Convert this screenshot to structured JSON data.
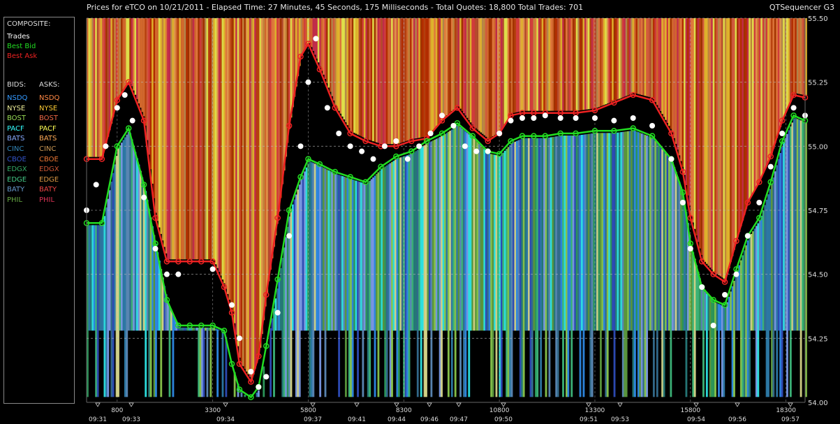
{
  "header": {
    "title": "Prices for  eTCO  on  10/21/2011  -  Elapsed Time: 27 Minutes, 45 Seconds, 175 Milliseconds  -  Total Quotes: 18,800  Total Trades: 701",
    "app": "QTSequencer G3"
  },
  "legend": {
    "composite_heading": "COMPOSITE:",
    "composite": [
      {
        "label": "Trades",
        "color": "#ffffff"
      },
      {
        "label": "Best Bid",
        "color": "#22dd22"
      },
      {
        "label": "Best Ask",
        "color": "#ee2222"
      }
    ],
    "bids_heading": "BIDS:",
    "asks_heading": "ASKS:",
    "exchanges": [
      {
        "bid": "NSDQ",
        "ask": "NSDQ",
        "bid_color": "#3399ff",
        "ask_color": "#ff8844"
      },
      {
        "bid": "NYSE",
        "ask": "NYSE",
        "bid_color": "#eeee99",
        "ask_color": "#ffcc33"
      },
      {
        "bid": "BOST",
        "ask": "BOST",
        "bid_color": "#99dd55",
        "ask_color": "#ee6644"
      },
      {
        "bid": "PACF",
        "ask": "PACF",
        "bid_color": "#33ffff",
        "ask_color": "#ffff55"
      },
      {
        "bid": "BATS",
        "ask": "BATS",
        "bid_color": "#88aaff",
        "ask_color": "#ffaa55"
      },
      {
        "bid": "CINC",
        "ask": "CINC",
        "bid_color": "#3388bb",
        "ask_color": "#cc9955"
      },
      {
        "bid": "CBOE",
        "ask": "CBOE",
        "bid_color": "#3355cc",
        "ask_color": "#ee7733"
      },
      {
        "bid": "EDGX",
        "ask": "EDGX",
        "bid_color": "#33aa66",
        "ask_color": "#cc5533"
      },
      {
        "bid": "EDGE",
        "ask": "EDGE",
        "bid_color": "#44cc88",
        "ask_color": "#dd9944"
      },
      {
        "bid": "BATY",
        "ask": "BATY",
        "bid_color": "#6699cc",
        "ask_color": "#ee4444"
      },
      {
        "bid": "PHIL",
        "ask": "PHIL",
        "bid_color": "#66aa44",
        "ask_color": "#dd3355"
      }
    ]
  },
  "chart_data": {
    "type": "line",
    "ylim": [
      54.0,
      55.5
    ],
    "y_ticks": [
      "55.50",
      "55.25",
      "55.00",
      "54.75",
      "54.50",
      "54.25",
      "54.00"
    ],
    "x_count_labels": [
      "800",
      "3300",
      "5800",
      "8300",
      "10800",
      "13300",
      "15800",
      "18300"
    ],
    "x_time_labels": [
      "09:31",
      "09:33",
      "09:34",
      "09:37",
      "09:41",
      "09:44",
      "09:46",
      "09:47",
      "09:50",
      "09:51",
      "09:53",
      "09:54",
      "09:56",
      "09:57"
    ],
    "xlim": [
      0,
      18800
    ],
    "best_bid": {
      "x": [
        0,
        400,
        800,
        1100,
        1500,
        1800,
        2100,
        2400,
        2700,
        3000,
        3300,
        3600,
        3800,
        4000,
        4300,
        4500,
        4700,
        5000,
        5300,
        5600,
        5800,
        6100,
        6500,
        6900,
        7300,
        7700,
        8100,
        8500,
        8900,
        9300,
        9700,
        10100,
        10500,
        10800,
        11100,
        11400,
        11700,
        12000,
        12400,
        12800,
        13300,
        13800,
        14300,
        14800,
        15300,
        15600,
        15800,
        16100,
        16400,
        16700,
        17000,
        17300,
        17600,
        17900,
        18200,
        18500,
        18800
      ],
      "y": [
        54.7,
        54.7,
        55.0,
        55.07,
        54.85,
        54.62,
        54.4,
        54.3,
        54.3,
        54.3,
        54.3,
        54.28,
        54.15,
        54.05,
        54.02,
        54.06,
        54.22,
        54.48,
        54.75,
        54.88,
        54.95,
        54.93,
        54.9,
        54.88,
        54.86,
        54.92,
        54.96,
        54.98,
        55.02,
        55.05,
        55.09,
        55.04,
        54.98,
        54.97,
        55.02,
        55.04,
        55.04,
        55.04,
        55.05,
        55.05,
        55.06,
        55.06,
        55.07,
        55.04,
        54.95,
        54.82,
        54.62,
        54.45,
        54.4,
        54.38,
        54.52,
        54.65,
        54.72,
        54.86,
        55.02,
        55.12,
        55.1
      ]
    },
    "best_ask": {
      "x": [
        0,
        400,
        800,
        1100,
        1500,
        1800,
        2100,
        2400,
        2700,
        3000,
        3300,
        3600,
        3800,
        4000,
        4300,
        4500,
        4700,
        5000,
        5300,
        5600,
        5800,
        6100,
        6500,
        6900,
        7300,
        7700,
        8100,
        8500,
        8900,
        9300,
        9700,
        10100,
        10500,
        10800,
        11100,
        11400,
        11700,
        12000,
        12400,
        12800,
        13300,
        13800,
        14300,
        14800,
        15300,
        15600,
        15800,
        16100,
        16400,
        16700,
        17000,
        17300,
        17600,
        17900,
        18200,
        18500,
        18800
      ],
      "y": [
        54.95,
        54.95,
        55.18,
        55.25,
        55.1,
        54.72,
        54.55,
        54.55,
        54.55,
        54.55,
        54.55,
        54.45,
        54.35,
        54.15,
        54.08,
        54.18,
        54.42,
        54.72,
        55.08,
        55.35,
        55.4,
        55.3,
        55.15,
        55.05,
        55.02,
        55.0,
        55.0,
        55.02,
        55.03,
        55.1,
        55.15,
        55.07,
        55.02,
        55.05,
        55.12,
        55.13,
        55.13,
        55.13,
        55.13,
        55.13,
        55.14,
        55.17,
        55.2,
        55.18,
        55.05,
        54.9,
        54.72,
        54.55,
        54.5,
        54.47,
        54.63,
        54.78,
        54.86,
        54.96,
        55.1,
        55.2,
        55.19
      ]
    },
    "trades": {
      "x": [
        0,
        250,
        500,
        800,
        1000,
        1200,
        1500,
        1800,
        2100,
        2400,
        3300,
        3800,
        4000,
        4300,
        4500,
        4700,
        5000,
        5300,
        5600,
        5800,
        6000,
        6300,
        6600,
        6900,
        7200,
        7500,
        7800,
        8100,
        8400,
        8700,
        9000,
        9300,
        9600,
        9900,
        10200,
        10500,
        10800,
        11100,
        11400,
        11700,
        12000,
        12400,
        12800,
        13300,
        13800,
        14300,
        14800,
        15300,
        15600,
        15800,
        16100,
        16400,
        16700,
        17000,
        17300,
        17600,
        17900,
        18200,
        18500,
        18800
      ],
      "y": [
        54.75,
        54.85,
        55.0,
        55.15,
        55.2,
        55.1,
        54.8,
        54.6,
        54.5,
        54.5,
        54.52,
        54.38,
        54.25,
        54.12,
        54.06,
        54.1,
        54.35,
        54.65,
        55.0,
        55.25,
        55.42,
        55.15,
        55.05,
        55.0,
        54.98,
        54.95,
        55.0,
        55.02,
        54.95,
        55.0,
        55.05,
        55.12,
        55.08,
        55.0,
        54.98,
        54.98,
        55.05,
        55.1,
        55.11,
        55.11,
        55.12,
        55.11,
        55.11,
        55.11,
        55.1,
        55.11,
        55.08,
        54.95,
        54.78,
        54.6,
        54.45,
        54.3,
        54.42,
        54.5,
        54.65,
        54.78,
        54.92,
        55.05,
        55.15,
        55.12
      ]
    },
    "bid_depth_floor": 54.28,
    "ask_depth_ceiling": 55.5
  }
}
